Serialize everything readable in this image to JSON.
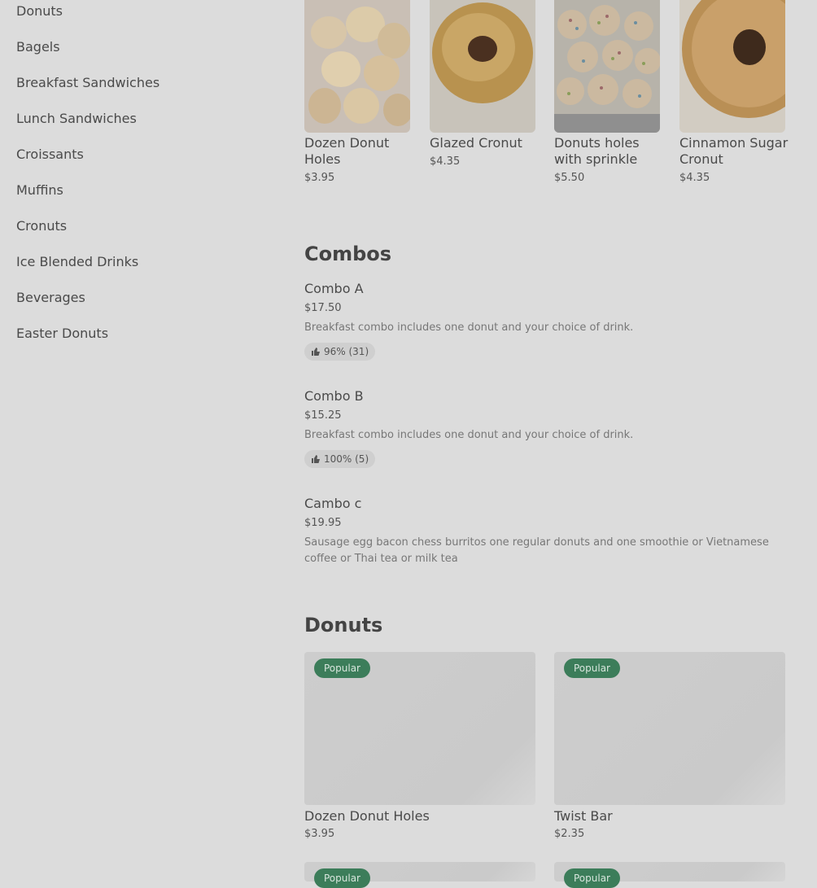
{
  "sidebar": {
    "items": [
      {
        "label": "Donuts"
      },
      {
        "label": "Bagels"
      },
      {
        "label": "Breakfast Sandwiches"
      },
      {
        "label": "Lunch Sandwiches"
      },
      {
        "label": "Croissants"
      },
      {
        "label": "Muffins"
      },
      {
        "label": "Cronuts"
      },
      {
        "label": "Ice Blended Drinks"
      },
      {
        "label": "Beverages"
      },
      {
        "label": "Easter Donuts"
      }
    ]
  },
  "featured": [
    {
      "name": "Dozen Donut Holes",
      "price": "$3.95"
    },
    {
      "name": "Glazed Cronut",
      "price": "$4.35"
    },
    {
      "name": "Donuts holes with sprinkle",
      "price": "$5.50"
    },
    {
      "name": "Cinnamon Sugar Cronut",
      "price": "$4.35"
    }
  ],
  "combos": {
    "title": "Combos",
    "items": [
      {
        "name": "Combo A",
        "price": "$17.50",
        "desc": "Breakfast combo includes one donut and your choice of drink.",
        "rating": "96% (31)"
      },
      {
        "name": "Combo B",
        "price": "$15.25",
        "desc": "Breakfast combo includes one donut and your choice of drink.",
        "rating": "100% (5)"
      },
      {
        "name": "Cambo c",
        "price": "$19.95",
        "desc": "Sausage egg bacon chess burritos one regular donuts and one smoothie or Vietnamese coffee or Thai tea or milk tea"
      }
    ]
  },
  "donuts": {
    "title": "Donuts",
    "items": [
      {
        "badge": "Popular",
        "name": "Dozen Donut Holes",
        "price": "$3.95"
      },
      {
        "badge": "Popular",
        "name": "Twist Bar",
        "price": "$2.35"
      },
      {
        "badge": "Popular"
      },
      {
        "badge": "Popular"
      }
    ]
  },
  "colors": {
    "accent": "#3c7d5a",
    "background": "#dcdcdc"
  }
}
